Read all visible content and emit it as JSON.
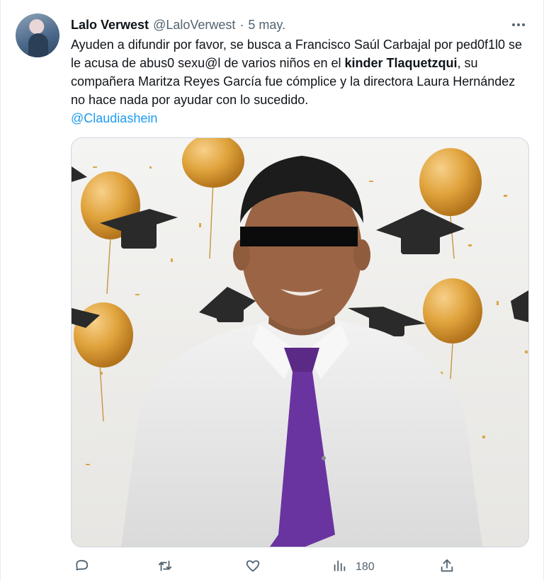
{
  "tweet": {
    "name": "Lalo Verwest",
    "handle": "@LaloVerwest",
    "separator": "·",
    "date": "5 may.",
    "text_1": "Ayuden a difundir por favor, se busca a Francisco Saúl Carbajal por ped0f1l0 se le acusa de abus0 sexu@l de varios niños en el ",
    "text_bold": "kinder Tlaquetzqui",
    "text_2": ", su compañera Maritza Reyes García fue cómplice y la directora Laura Hernández no hace nada por ayudar con lo sucedido.",
    "mention": "@Claudiashein"
  },
  "actions": {
    "reply_icon": "reply-icon",
    "retweet_icon": "retweet-icon",
    "like_icon": "like-icon",
    "views_icon": "views-icon",
    "views_count": "180",
    "share_icon": "share-icon"
  },
  "colors": {
    "link": "#1d9bf0",
    "secondary_text": "#536471",
    "balloon_gold": "#e0a33c",
    "tie_purple": "#5b2a86"
  }
}
